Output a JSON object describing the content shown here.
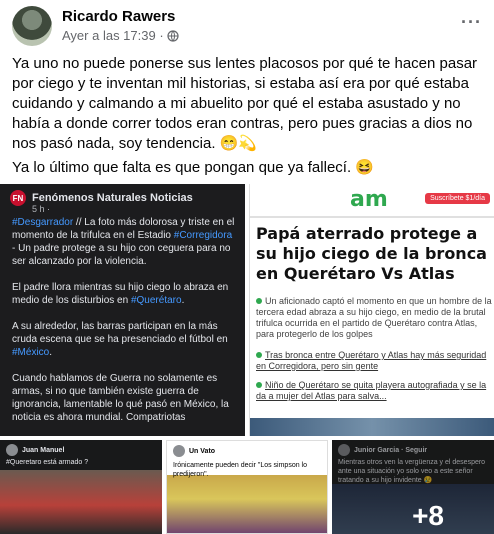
{
  "post": {
    "author": "Ricardo Rawers",
    "timestamp": "Ayer a las 17:39 ·",
    "paragraphs": [
      "Ya uno no puede ponerse sus lentes placosos por qué te hacen pasar por ciego y te inventan mil historias, si estaba así era por qué estaba cuidando  y calmando a mi abuelito por qué el estaba asustado y no había a donde correr todos eran contras, pero pues gracias a dios no nos pasó nada, soy tendencia. 😁💫",
      "Ya lo último que falta es que pongan que ya fallecí. 😆"
    ]
  },
  "images": {
    "left": {
      "page_name": "Fenómenos Naturales Noticias",
      "time": "5 h · ",
      "logo_text": "FN",
      "p1_hash1": "#Desgarrador",
      "p1_text1": " // La foto más dolorosa y triste en el momento de la trifulca en el Estadio ",
      "p1_hash2": "#Corregidora",
      "p1_text2": " - Un padre protege a su hijo con ceguera para no ser alcanzado por la violencia.",
      "p2_text": "El padre llora mientras su hijo ciego lo abraza en medio de los disturbios en ",
      "p2_hash": "#Querétaro",
      "p2_end": ".",
      "p3_text": "A su alrededor, las barras participan en la más cruda escena que se ha presenciado el fútbol en ",
      "p3_hash": "#México",
      "p3_end": ".",
      "p4_text": "Cuando hablamos de Guerra no solamente es armas, si no que también existe guerra de ignorancia, lamentable lo qué pasó en México, la noticia es ahora mundial. Compatriotas"
    },
    "right": {
      "logo": "am",
      "subscribe": "Suscríbete $1/día",
      "title": "Papá aterrado protege a su hijo ciego de la bronca en Querétaro Vs Atlas",
      "bullet1": "Un aficionado captó el momento en que un hombre de la tercera edad abraza a su hijo ciego, en medio de la brutal trifulca ocurrida en el partido de Querétaro contra Atlas, para protegerlo de los golpes",
      "bullet2": "Tras bronca entre Querétaro y Atlas hay más seguridad en Corregidora, pero sin gente",
      "bullet3": "Niño de Querétaro se quita playera autografiada y se la da a mujer del Atlas para salva..."
    },
    "thumbs": [
      {
        "name": "Juan Manuel",
        "text": "#Queretaro está armado ?"
      },
      {
        "name": "Un Vato",
        "text": "Irónicamente pueden decir \"Los simpson lo predijeron\"."
      },
      {
        "name": "Junior Garcia · Seguir",
        "text": "Mientras otros ven la vergüenza y el desespero ante una situación yo solo veo a este señor tratando a su hijo invidente 😢"
      }
    ],
    "more_count": "+8"
  }
}
